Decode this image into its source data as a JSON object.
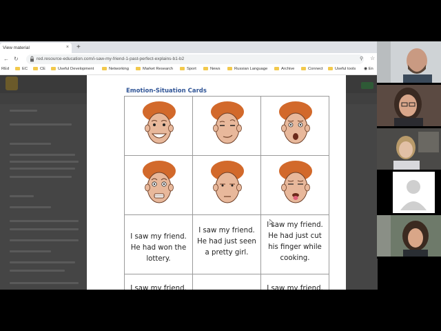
{
  "browser": {
    "tab_title": "View material",
    "tab_close": "×",
    "new_tab": "+",
    "url": "red.resource-education.com/i-saw-my-friend-1-past-perfect-explains-b1-b2",
    "bookmarks": [
      "REd",
      "EC",
      "CE",
      "Useful Development",
      "Networking",
      "Market Research",
      "Sport",
      "News",
      "Russian Language",
      "Archive",
      "Connect",
      "Useful tools",
      "En"
    ]
  },
  "document": {
    "title": "Emotion-Situation Cards",
    "captions": [
      "I saw my friend. He had won the lottery.",
      "I saw my friend. He had just seen a pretty girl.",
      "I saw my friend. He had just cut his finger while cooking."
    ],
    "partial_captions": [
      "I saw my friend. He",
      "",
      "I saw my friend. He"
    ]
  },
  "faces": [
    {
      "expression": "laughing-happy"
    },
    {
      "expression": "smug-wink"
    },
    {
      "expression": "shocked-pain"
    },
    {
      "expression": "scared"
    },
    {
      "expression": "bored"
    },
    {
      "expression": "disgusted-tongue-out"
    }
  ],
  "colors": {
    "hair": "#d2692b",
    "skin": "#e8b89b",
    "doc_title": "#2f5496",
    "bookmark_folder": "#f2c94c"
  },
  "participants": [
    {
      "tile": "bald-man-beard"
    },
    {
      "tile": "woman-glasses"
    },
    {
      "tile": "woman-blonde"
    },
    {
      "tile": "no-video-placeholder"
    },
    {
      "tile": "woman-curly-hair"
    }
  ]
}
